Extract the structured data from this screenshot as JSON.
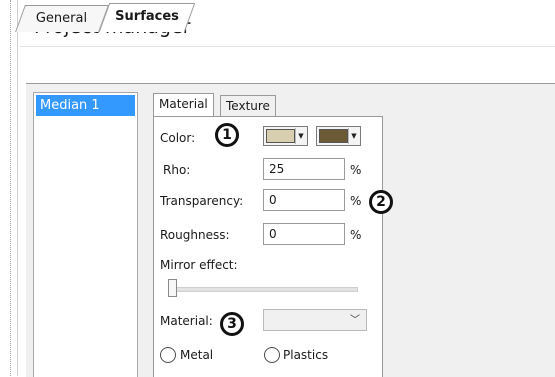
{
  "header": {
    "title": "Project manager"
  },
  "outer_tabs": [
    {
      "label": "General",
      "active": false
    },
    {
      "label": "Surfaces",
      "active": true
    }
  ],
  "surface_list": {
    "items": [
      "Median 1"
    ],
    "selected": "Median 1"
  },
  "inner_tabs": [
    {
      "label": "Material",
      "active": true
    },
    {
      "label": "Texture",
      "active": false
    }
  ],
  "material": {
    "color_label": "Color:",
    "color1": "#d8ceb0",
    "color2": "#6b5a35",
    "rho_label": "Rho:",
    "rho_value": "25",
    "transparency_label": "Transparency:",
    "transparency_value": "0",
    "roughness_label": "Roughness:",
    "roughness_value": "0",
    "unit": "%",
    "mirror_label": "Mirror effect:",
    "mirror_value_percent": 0,
    "material_label": "Material:",
    "material_value": "",
    "radio_metal": "Metal",
    "radio_plastics": "Plastics"
  },
  "callouts": [
    "1",
    "2",
    "3"
  ],
  "colors": {
    "selection": "#3399ff",
    "panel_bg": "#f0f0f0"
  }
}
